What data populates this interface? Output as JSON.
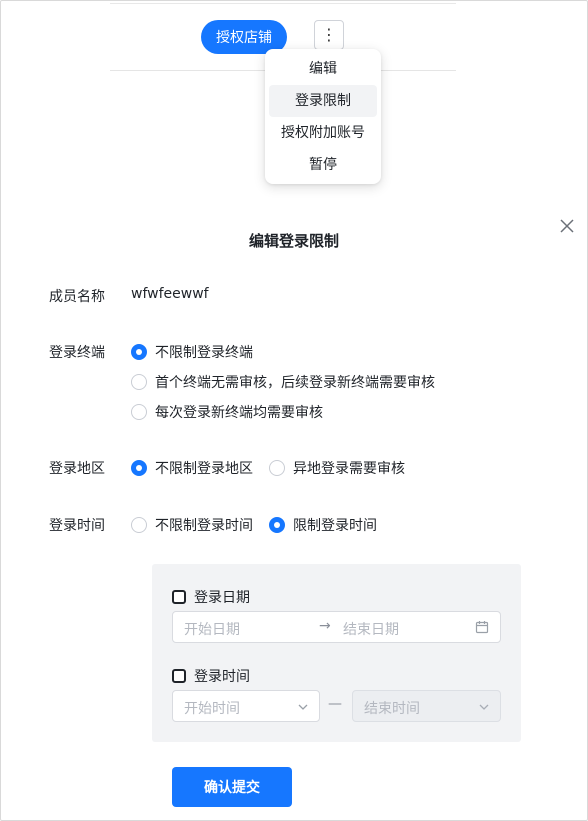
{
  "header": {
    "authorize_store_label": "授权店铺",
    "more_label": "⋮"
  },
  "dropdown": {
    "items": [
      {
        "label": "编辑"
      },
      {
        "label": "登录限制"
      },
      {
        "label": "授权附加账号"
      },
      {
        "label": "暂停"
      }
    ],
    "active_index": 1
  },
  "modal": {
    "title": "编辑登录限制",
    "member_name": {
      "label": "成员名称",
      "value": "wfwfeewwf"
    },
    "login_terminal": {
      "label": "登录终端",
      "options": [
        {
          "label": "不限制登录终端",
          "checked": true
        },
        {
          "label": "首个终端无需审核，后续登录新终端需要审核",
          "checked": false
        },
        {
          "label": "每次登录新终端均需要审核",
          "checked": false
        }
      ]
    },
    "login_region": {
      "label": "登录地区",
      "options": [
        {
          "label": "不限制登录地区",
          "checked": true
        },
        {
          "label": "异地登录需要审核",
          "checked": false
        }
      ]
    },
    "login_time": {
      "label": "登录时间",
      "options": [
        {
          "label": "不限制登录时间",
          "checked": false
        },
        {
          "label": "限制登录时间",
          "checked": true
        }
      ]
    },
    "time_panel": {
      "date_checkbox_label": "登录日期",
      "date_start_placeholder": "开始日期",
      "date_arrow": "→",
      "date_end_placeholder": "结束日期",
      "time_checkbox_label": "登录时间",
      "time_start_placeholder": "开始时间",
      "time_separator": "—",
      "time_end_placeholder": "结束时间"
    },
    "submit_label": "确认提交"
  },
  "colors": {
    "primary": "#1677ff",
    "panel_bg": "#f2f3f5"
  }
}
